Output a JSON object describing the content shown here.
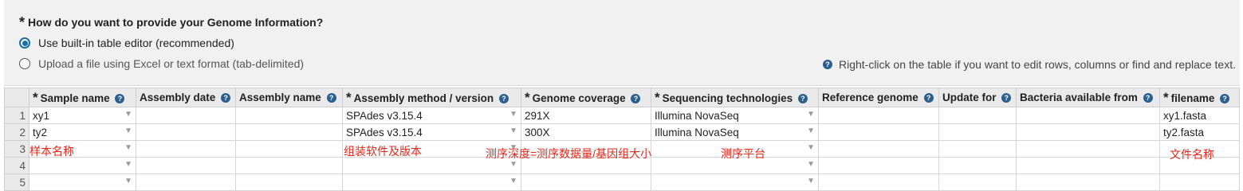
{
  "form": {
    "question": "How do you want to provide your Genome Information?",
    "option_editor": "Use built-in table editor (recommended)",
    "option_upload": "Upload a file using Excel or text format (tab-delimited)",
    "hint": "Right-click on the table if you want to edit rows, columns or find and replace text."
  },
  "table": {
    "columns": [
      {
        "label": "Sample name",
        "required": true
      },
      {
        "label": "Assembly date",
        "required": false
      },
      {
        "label": "Assembly name",
        "required": false
      },
      {
        "label": "Assembly method / version",
        "required": true
      },
      {
        "label": "Genome coverage",
        "required": true
      },
      {
        "label": "Sequencing technologies",
        "required": true
      },
      {
        "label": "Reference genome",
        "required": false
      },
      {
        "label": "Update for",
        "required": false
      },
      {
        "label": "Bacteria available from",
        "required": false
      },
      {
        "label": "filename",
        "required": true
      }
    ],
    "rows": [
      {
        "num": "1",
        "sample": "xy1",
        "date": "",
        "name": "",
        "method": "SPAdes  v3.15.4",
        "coverage": "291X",
        "tech": "Illumina NovaSeq",
        "ref": "",
        "update": "",
        "bacteria": "",
        "filename": "xy1.fasta"
      },
      {
        "num": "2",
        "sample": "ty2",
        "date": "",
        "name": "",
        "method": "SPAdes  v3.15.4",
        "coverage": "300X",
        "tech": "Illumina NovaSeq",
        "ref": "",
        "update": "",
        "bacteria": "",
        "filename": "ty2.fasta"
      },
      {
        "num": "3",
        "sample": "",
        "date": "",
        "name": "",
        "method": "",
        "coverage": "",
        "tech": "",
        "ref": "",
        "update": "",
        "bacteria": "",
        "filename": ""
      },
      {
        "num": "4",
        "sample": "",
        "date": "",
        "name": "",
        "method": "",
        "coverage": "",
        "tech": "",
        "ref": "",
        "update": "",
        "bacteria": "",
        "filename": ""
      },
      {
        "num": "5",
        "sample": "",
        "date": "",
        "name": "",
        "method": "",
        "coverage": "",
        "tech": "",
        "ref": "",
        "update": "",
        "bacteria": "",
        "filename": ""
      }
    ]
  },
  "annotations": {
    "sample_name": "样本名称",
    "assembly_software": "组装软件及版本",
    "coverage_formula": "测序深度=测序数据量/基因组大小",
    "platform": "测序平台",
    "filename": "文件名称"
  },
  "icons": {
    "required": "asterisk-icon",
    "help": "help-circle-icon",
    "dropdown": "dropdown-arrow-icon"
  },
  "colors": {
    "accent": "#1a6ea8",
    "help_icon": "#2b5f8f",
    "annotation": "#e0281b",
    "header_bg": "#eaeaea"
  }
}
